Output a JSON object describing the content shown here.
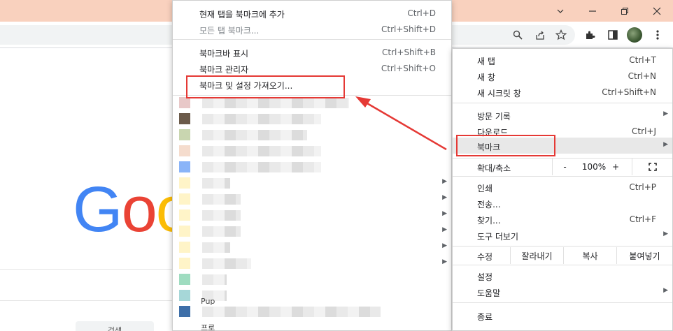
{
  "window": {
    "minimize_glyph": "⌄",
    "buttons": [
      "chevron-down-icon",
      "minimize-icon",
      "restore-icon",
      "close-icon"
    ]
  },
  "toolbar": {
    "icons": [
      "search-icon",
      "share-icon",
      "star-icon",
      "extensions-icon",
      "sidepanel-icon",
      "avatar",
      "more-icon"
    ]
  },
  "page": {
    "logo_letters": [
      "G",
      "o",
      "o"
    ],
    "logo_colors": [
      "#4285f4",
      "#ea4335",
      "#fbbc05"
    ],
    "bottom_tab_text": "검색"
  },
  "bookmarks_menu": {
    "items": [
      {
        "label": "현재 탭을 북마크에 추가",
        "shortcut": "Ctrl+D",
        "disabled": false
      },
      {
        "label": "모든 탭 북마크...",
        "shortcut": "Ctrl+Shift+D",
        "disabled": true
      },
      {
        "label": "북마크바 표시",
        "shortcut": "Ctrl+Shift+B",
        "disabled": false
      },
      {
        "label": "북마크 관리자",
        "shortcut": "Ctrl+Shift+O",
        "disabled": false
      },
      {
        "label": "북마크 및 설정 가져오기...",
        "shortcut": "",
        "disabled": false
      }
    ],
    "bookmark_rows": [
      {
        "favicon_color": "#e8c8c8",
        "has_submenu": false
      },
      {
        "favicon_color": "#6b5a4a",
        "has_submenu": false
      },
      {
        "favicon_color": "#c9d6b0",
        "has_submenu": false
      },
      {
        "favicon_color": "#f5dccd",
        "has_submenu": false
      },
      {
        "favicon_color": "#8ab4f8",
        "has_submenu": false
      },
      {
        "favicon_color": "#fff4c8",
        "has_submenu": true
      },
      {
        "favicon_color": "#fff4c8",
        "has_submenu": true
      },
      {
        "favicon_color": "#fff4c8",
        "has_submenu": true
      },
      {
        "favicon_color": "#fff4c8",
        "has_submenu": true
      },
      {
        "favicon_color": "#fff4c8",
        "has_submenu": true
      },
      {
        "favicon_color": "#fff4c8",
        "has_submenu": true
      },
      {
        "favicon_color": "#9fdcc0",
        "has_submenu": false
      },
      {
        "favicon_color": "#a6d7d8",
        "has_submenu": false
      },
      {
        "favicon_color": "#3e6fa8",
        "has_submenu": false
      }
    ],
    "partial_text_1": "Pup",
    "partial_text_2": "프로"
  },
  "chrome_menu": {
    "group1": [
      {
        "label": "새 탭",
        "shortcut": "Ctrl+T"
      },
      {
        "label": "새 창",
        "shortcut": "Ctrl+N"
      },
      {
        "label": "새 시크릿 창",
        "shortcut": "Ctrl+Shift+N"
      }
    ],
    "group2": [
      {
        "label": "방문 기록",
        "shortcut": "",
        "arrow": true
      },
      {
        "label": "다운로드",
        "shortcut": "Ctrl+J",
        "arrow": false
      },
      {
        "label": "북마크",
        "shortcut": "",
        "arrow": true,
        "active": true
      }
    ],
    "zoom": {
      "label": "확대/축소",
      "minus": "-",
      "value": "100%",
      "plus": "+"
    },
    "group3": [
      {
        "label": "인쇄",
        "shortcut": "Ctrl+P",
        "arrow": false
      },
      {
        "label": "전송...",
        "shortcut": "",
        "arrow": false
      },
      {
        "label": "찾기...",
        "shortcut": "Ctrl+F",
        "arrow": false
      },
      {
        "label": "도구 더보기",
        "shortcut": "",
        "arrow": true
      }
    ],
    "edit": {
      "label": "수정",
      "cut": "잘라내기",
      "copy": "복사",
      "paste": "붙여넣기"
    },
    "group4": [
      {
        "label": "설정",
        "arrow": false
      },
      {
        "label": "도움말",
        "arrow": true
      }
    ],
    "exit": "종료"
  },
  "colors": {
    "titlebar": "#f9d1be",
    "annotation_red": "#e53935"
  }
}
